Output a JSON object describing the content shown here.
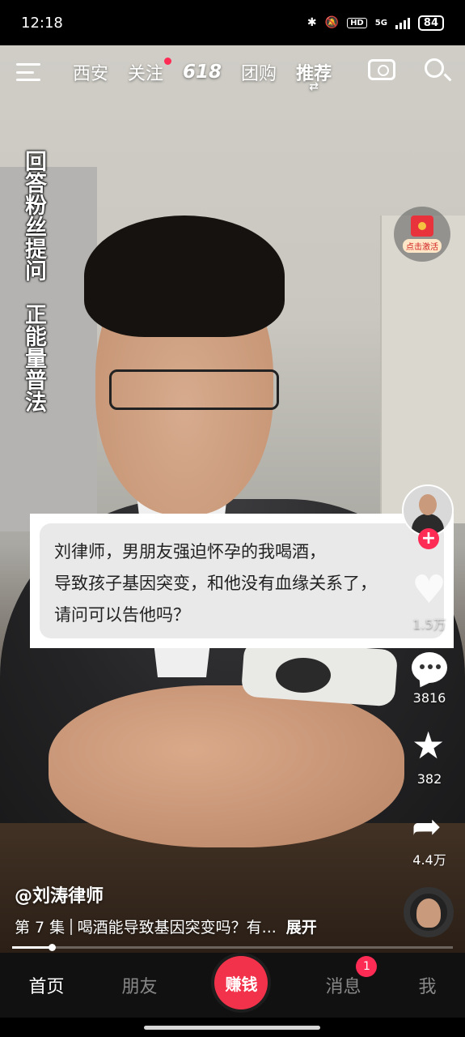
{
  "status_bar": {
    "time": "12:18",
    "network": "5G",
    "hd": "HD",
    "battery": "84"
  },
  "top_nav": {
    "items": [
      {
        "label": "西安"
      },
      {
        "label": "关注",
        "has_dot": true
      },
      {
        "label": "618"
      },
      {
        "label": "团购"
      },
      {
        "label": "推荐",
        "active": true
      }
    ],
    "refresh_glyph": "⇄"
  },
  "video": {
    "vertical_caption": "回答粉丝提问　正能量普法",
    "red_packet_label": "点击激活",
    "question_card": {
      "lines": [
        "刘律师，男朋友强迫怀孕的我喝酒，",
        "导致孩子基因突变，和他没有血缘关系了，",
        "请问可以告他吗？"
      ]
    }
  },
  "side_actions": {
    "follow_plus": "+",
    "likes": "1.5万",
    "comments": "3816",
    "favorites": "382",
    "shares": "4.4万"
  },
  "post": {
    "author": "@刘涛律师",
    "episode": "第 7 集",
    "title": "喝酒能导致基因突变吗？有...",
    "expand_label": "展开",
    "progress": 0.09
  },
  "bottom_nav": {
    "tabs": [
      {
        "label": "首页",
        "active": true
      },
      {
        "label": "朋友"
      },
      {
        "label": "赚钱",
        "center": true
      },
      {
        "label": "消息",
        "badge": "1"
      },
      {
        "label": "我"
      }
    ]
  },
  "colors": {
    "accent": "#fe2c55",
    "earn_button": "#f2324a"
  }
}
